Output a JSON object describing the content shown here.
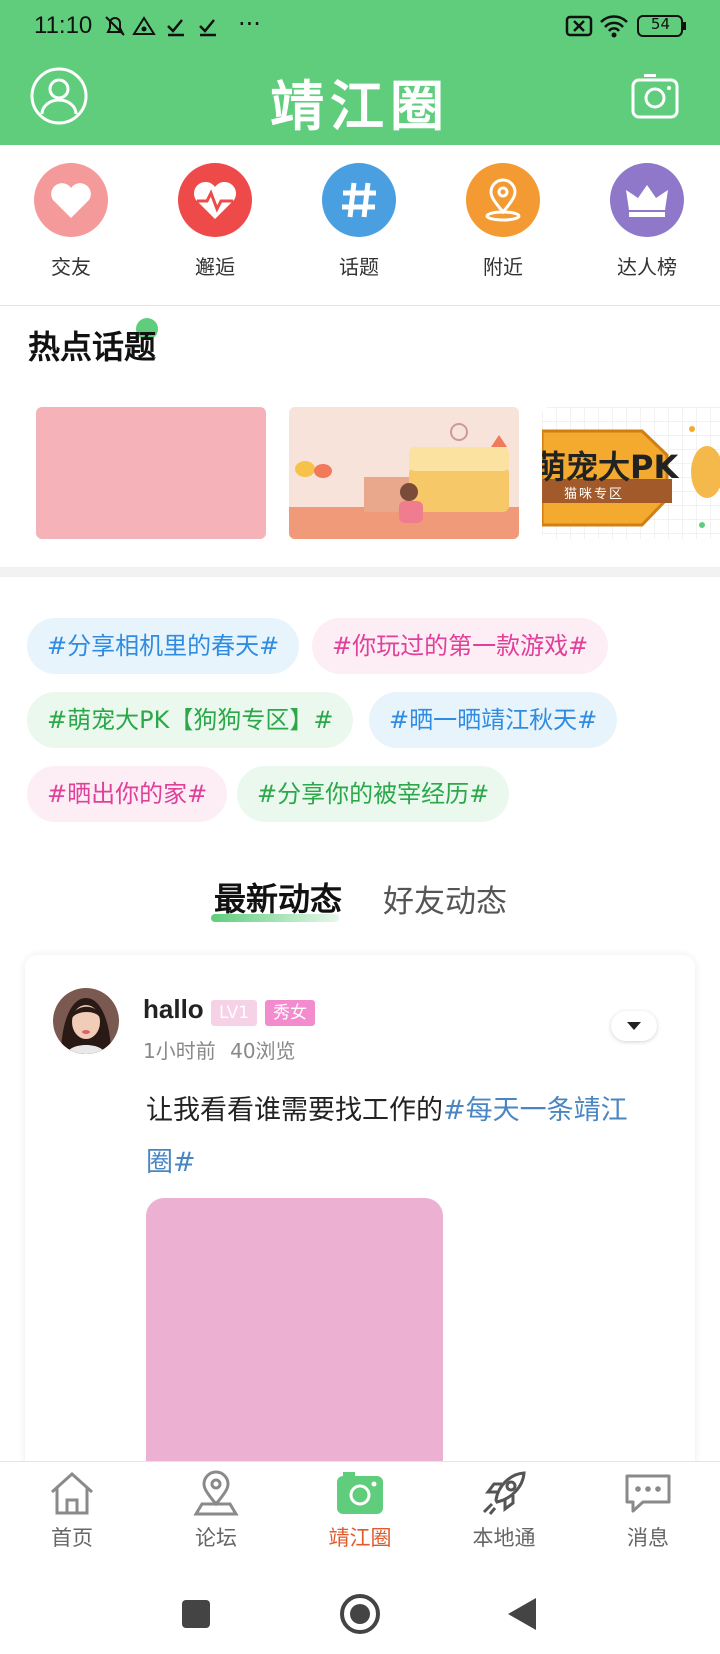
{
  "status_bar": {
    "time": "11:10",
    "battery": "54",
    "more": "···"
  },
  "app_bar": {
    "title": "靖江圈"
  },
  "quick_actions": [
    {
      "label": "交友",
      "icon": "heart-icon",
      "color": "#f59a9a"
    },
    {
      "label": "邂逅",
      "icon": "heartbeat-icon",
      "color": "#ef4a4a"
    },
    {
      "label": "话题",
      "icon": "hashtag-icon",
      "color": "#4a9fe0"
    },
    {
      "label": "附近",
      "icon": "location-pin-icon",
      "color": "#f39a33"
    },
    {
      "label": "达人榜",
      "icon": "crown-icon",
      "color": "#8f78c9"
    }
  ],
  "hot_topics": {
    "title": "热点话题",
    "banners": [
      {
        "caption": ""
      },
      {
        "caption": ""
      },
      {
        "caption": "萌宠大PK",
        "sub": "猫咪专区"
      }
    ]
  },
  "tags": [
    {
      "text": "#分享相机里的春天#",
      "color": "#2f8ce0",
      "bg": "#e8f4fc"
    },
    {
      "text": "#你玩过的第一款游戏#",
      "color": "#e0409a",
      "bg": "#fdeef5"
    },
    {
      "text": "#萌宠大PK【狗狗专区】#",
      "color": "#2ca84a",
      "bg": "#eaf8ee"
    },
    {
      "text": "#晒一晒靖江秋天#",
      "color": "#2f8ce0",
      "bg": "#e8f4fc"
    },
    {
      "text": "#晒出你的家#",
      "color": "#e0409a",
      "bg": "#fdeef5"
    },
    {
      "text": "#分享你的被宰经历#",
      "color": "#2ca84a",
      "bg": "#eaf8ee"
    }
  ],
  "feed_tabs": {
    "active": "最新动态",
    "other": "好友动态"
  },
  "post": {
    "username": "hallo",
    "level": "LV1",
    "title_badge": "秀女",
    "time": "1小时前",
    "views": "40浏览",
    "text": "让我看看谁需要找工作的",
    "topic": "#每天一条靖江圈#"
  },
  "bottom_nav": [
    {
      "label": "首页",
      "icon": "home-icon",
      "active": false
    },
    {
      "label": "论坛",
      "icon": "location-icon",
      "active": false
    },
    {
      "label": "靖江圈",
      "icon": "camera-icon",
      "active": true
    },
    {
      "label": "本地通",
      "icon": "rocket-icon",
      "active": false
    },
    {
      "label": "消息",
      "icon": "chat-icon",
      "active": false
    }
  ],
  "colors": {
    "brand_green": "#5fcd7c",
    "active_tab": "#e05a2b"
  }
}
